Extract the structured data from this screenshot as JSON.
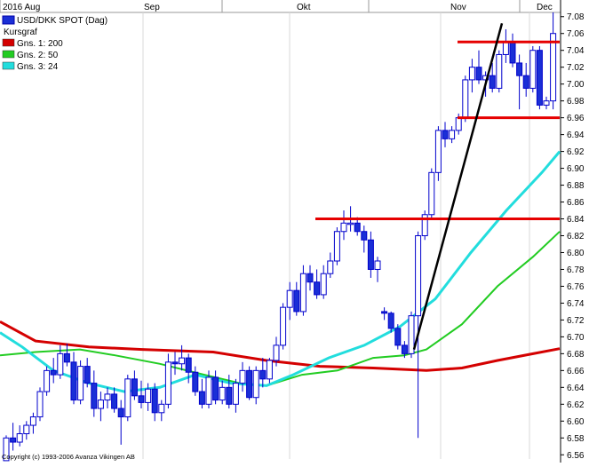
{
  "chart_data": {
    "type": "candlestick",
    "title": "USD/DKK SPOT (Dag)",
    "legend_placement": "top-left",
    "legend": [
      {
        "label": "Kursgraf",
        "color": "#0000cc"
      },
      {
        "label": "Gns. 1: 200",
        "color": "#d40000"
      },
      {
        "label": "Gns. 2: 50",
        "color": "#22cc22"
      },
      {
        "label": "Gns. 3: 24",
        "color": "#22dddd"
      }
    ],
    "x_tick_labels": [
      "2016 Aug",
      "Sep",
      "Okt",
      "Nov",
      "Dec"
    ],
    "copyright": "Copyright (c) 1993-2006 Avanza Vikingen AB",
    "ylim": [
      6.555,
      7.085
    ],
    "y_ticks": [
      "7.08",
      "7.06",
      "7.04",
      "7.02",
      "7.00",
      "6.98",
      "6.96",
      "6.94",
      "6.92",
      "6.90",
      "6.88",
      "6.86",
      "6.84",
      "6.82",
      "6.80",
      "6.78",
      "6.76",
      "6.74",
      "6.72",
      "6.70",
      "6.68",
      "6.66",
      "6.64",
      "6.62",
      "6.60",
      "6.58",
      "6.56"
    ],
    "grid": "vertical only",
    "colors": {
      "bull_fill": "#ffffff",
      "bear_fill": "#1a2fd6",
      "candle_edge": "#0000cc",
      "ma200": "#d40000",
      "ma50": "#22cc22",
      "ma24": "#22dddd",
      "levels": "#e60000",
      "trendline": "#000000"
    },
    "candles": [
      [
        6.553,
        6.583,
        6.553,
        6.58
      ],
      [
        6.58,
        6.598,
        6.565,
        6.575
      ],
      [
        6.575,
        6.595,
        6.57,
        6.585
      ],
      [
        6.585,
        6.6,
        6.578,
        6.595
      ],
      [
        6.595,
        6.61,
        6.585,
        6.605
      ],
      [
        6.605,
        6.64,
        6.6,
        6.635
      ],
      [
        6.635,
        6.665,
        6.63,
        6.66
      ],
      [
        6.66,
        6.675,
        6.645,
        6.655
      ],
      [
        6.655,
        6.69,
        6.65,
        6.68
      ],
      [
        6.68,
        6.692,
        6.665,
        6.67
      ],
      [
        6.67,
        6.682,
        6.62,
        6.625
      ],
      [
        6.625,
        6.672,
        6.62,
        6.665
      ],
      [
        6.665,
        6.675,
        6.64,
        6.645
      ],
      [
        6.645,
        6.66,
        6.605,
        6.615
      ],
      [
        6.615,
        6.635,
        6.6,
        6.625
      ],
      [
        6.625,
        6.64,
        6.615,
        6.632
      ],
      [
        6.632,
        6.64,
        6.61,
        6.615
      ],
      [
        6.615,
        6.625,
        6.572,
        6.605
      ],
      [
        6.605,
        6.655,
        6.6,
        6.65
      ],
      [
        6.65,
        6.66,
        6.625,
        6.63
      ],
      [
        6.63,
        6.648,
        6.615,
        6.622
      ],
      [
        6.622,
        6.645,
        6.612,
        6.638
      ],
      [
        6.638,
        6.645,
        6.6,
        6.61
      ],
      [
        6.61,
        6.625,
        6.6,
        6.62
      ],
      [
        6.62,
        6.68,
        6.615,
        6.67
      ],
      [
        6.67,
        6.682,
        6.655,
        6.668
      ],
      [
        6.668,
        6.69,
        6.66,
        6.675
      ],
      [
        6.675,
        6.68,
        6.645,
        6.658
      ],
      [
        6.658,
        6.665,
        6.63,
        6.635
      ],
      [
        6.635,
        6.65,
        6.615,
        6.62
      ],
      [
        6.62,
        6.66,
        6.615,
        6.652
      ],
      [
        6.652,
        6.66,
        6.62,
        6.625
      ],
      [
        6.625,
        6.648,
        6.62,
        6.64
      ],
      [
        6.64,
        6.655,
        6.615,
        6.62
      ],
      [
        6.62,
        6.65,
        6.61,
        6.645
      ],
      [
        6.645,
        6.67,
        6.635,
        6.66
      ],
      [
        6.66,
        6.665,
        6.625,
        6.628
      ],
      [
        6.628,
        6.665,
        6.62,
        6.66
      ],
      [
        6.66,
        6.675,
        6.64,
        6.65
      ],
      [
        6.65,
        6.675,
        6.645,
        6.672
      ],
      [
        6.672,
        6.7,
        6.665,
        6.69
      ],
      [
        6.69,
        6.74,
        6.685,
        6.735
      ],
      [
        6.735,
        6.765,
        6.72,
        6.755
      ],
      [
        6.755,
        6.765,
        6.725,
        6.73
      ],
      [
        6.73,
        6.785,
        6.725,
        6.775
      ],
      [
        6.775,
        6.785,
        6.755,
        6.765
      ],
      [
        6.765,
        6.78,
        6.745,
        6.75
      ],
      [
        6.75,
        6.785,
        6.745,
        6.775
      ],
      [
        6.775,
        6.8,
        6.77,
        6.79
      ],
      [
        6.79,
        6.83,
        6.785,
        6.825
      ],
      [
        6.825,
        6.85,
        6.815,
        6.835
      ],
      [
        6.835,
        6.855,
        6.825,
        6.835
      ],
      [
        6.835,
        6.842,
        6.82,
        6.825
      ],
      [
        6.825,
        6.832,
        6.8,
        6.815
      ],
      [
        6.815,
        6.825,
        6.77,
        6.78
      ],
      [
        6.78,
        6.795,
        6.765,
        6.79
      ],
      [
        6.73,
        6.735,
        6.72,
        6.728
      ],
      [
        6.728,
        6.73,
        6.705,
        6.71
      ],
      [
        6.71,
        6.715,
        6.685,
        6.69
      ],
      [
        6.69,
        6.695,
        6.675,
        6.68
      ],
      [
        6.68,
        6.73,
        6.675,
        6.725
      ],
      [
        6.725,
        6.825,
        6.58,
        6.82
      ],
      [
        6.82,
        6.85,
        6.815,
        6.845
      ],
      [
        6.845,
        6.9,
        6.84,
        6.895
      ],
      [
        6.895,
        6.95,
        6.885,
        6.945
      ],
      [
        6.945,
        6.955,
        6.925,
        6.935
      ],
      [
        6.935,
        6.95,
        6.93,
        6.945
      ],
      [
        6.945,
        6.965,
        6.94,
        6.96
      ],
      [
        6.96,
        7.01,
        6.955,
        7.005
      ],
      [
        7.005,
        7.03,
        6.99,
        7.02
      ],
      [
        7.02,
        7.04,
        7.0,
        7.005
      ],
      [
        7.005,
        7.015,
        6.985,
        7.01
      ],
      [
        7.01,
        7.025,
        6.99,
        6.995
      ],
      [
        6.995,
        7.04,
        6.99,
        7.035
      ],
      [
        7.035,
        7.065,
        7.025,
        7.05
      ],
      [
        7.05,
        7.06,
        7.02,
        7.025
      ],
      [
        7.025,
        7.035,
        6.97,
        7.01
      ],
      [
        7.01,
        7.025,
        6.985,
        6.995
      ],
      [
        6.995,
        7.045,
        6.99,
        7.04
      ],
      [
        7.04,
        7.045,
        6.97,
        6.975
      ],
      [
        6.975,
        6.985,
        6.97,
        6.98
      ],
      [
        6.98,
        7.085,
        6.97,
        7.06
      ]
    ],
    "ma200": [
      [
        0,
        6.718
      ],
      [
        40,
        6.695
      ],
      [
        100,
        6.688
      ],
      [
        160,
        6.685
      ],
      [
        240,
        6.682
      ],
      [
        300,
        6.672
      ],
      [
        360,
        6.665
      ],
      [
        420,
        6.663
      ],
      [
        480,
        6.66
      ],
      [
        520,
        6.663
      ],
      [
        560,
        6.672
      ],
      [
        600,
        6.68
      ],
      [
        630,
        6.686
      ]
    ],
    "ma50": [
      [
        0,
        6.678
      ],
      [
        40,
        6.682
      ],
      [
        90,
        6.685
      ],
      [
        130,
        6.678
      ],
      [
        180,
        6.668
      ],
      [
        230,
        6.655
      ],
      [
        270,
        6.645
      ],
      [
        300,
        6.642
      ],
      [
        340,
        6.655
      ],
      [
        380,
        6.66
      ],
      [
        420,
        6.675
      ],
      [
        455,
        6.678
      ],
      [
        480,
        6.685
      ],
      [
        520,
        6.715
      ],
      [
        560,
        6.76
      ],
      [
        600,
        6.795
      ],
      [
        630,
        6.825
      ]
    ],
    "ma24": [
      [
        0,
        6.705
      ],
      [
        25,
        6.688
      ],
      [
        60,
        6.66
      ],
      [
        100,
        6.645
      ],
      [
        140,
        6.635
      ],
      [
        180,
        6.64
      ],
      [
        220,
        6.655
      ],
      [
        260,
        6.645
      ],
      [
        300,
        6.642
      ],
      [
        330,
        6.655
      ],
      [
        370,
        6.675
      ],
      [
        410,
        6.69
      ],
      [
        450,
        6.712
      ],
      [
        490,
        6.745
      ],
      [
        530,
        6.8
      ],
      [
        570,
        6.85
      ],
      [
        610,
        6.895
      ],
      [
        630,
        6.92
      ]
    ],
    "levels": [
      {
        "y": 7.05,
        "x_from": 515,
        "x_to": 630
      },
      {
        "y": 6.96,
        "x_from": 515,
        "x_to": 630
      },
      {
        "y": 6.84,
        "x_from": 355,
        "x_to": 630
      }
    ],
    "trendline": {
      "from": [
        466,
        6.685
      ],
      "to": [
        565,
        7.072
      ]
    }
  }
}
